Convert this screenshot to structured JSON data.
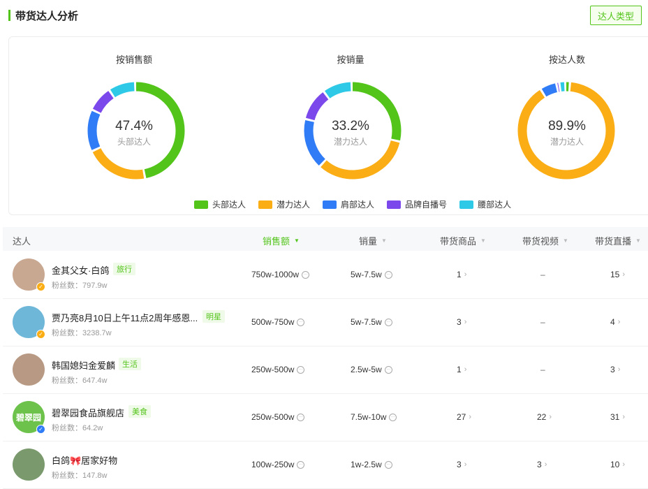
{
  "header": {
    "title": "带货达人分析",
    "type_button": "达人类型"
  },
  "colors": {
    "head": "#52c41a",
    "potential": "#faad14",
    "shoulder": "#2f7cf6",
    "brand": "#7b48ec",
    "waist": "#2ec9e6"
  },
  "charts": [
    {
      "title": "按销售额",
      "center_pct": "47.4%",
      "center_label": "头部达人"
    },
    {
      "title": "按销量",
      "center_pct": "33.2%",
      "center_label": "潜力达人"
    },
    {
      "title": "按达人数",
      "center_pct": "89.9%",
      "center_label": "潜力达人"
    }
  ],
  "chart_data": [
    {
      "type": "pie",
      "title": "按销售额",
      "categories": [
        "头部达人",
        "潜力达人",
        "肩部达人",
        "品牌自播号",
        "腰部达人"
      ],
      "values": [
        47.4,
        21.0,
        14.0,
        8.6,
        9.0
      ]
    },
    {
      "type": "pie",
      "title": "按销量",
      "categories": [
        "头部达人",
        "潜力达人",
        "肩部达人",
        "品牌自播号",
        "腰部达人"
      ],
      "values": [
        29.0,
        33.2,
        17.0,
        11.0,
        9.8
      ]
    },
    {
      "type": "pie",
      "title": "按达人数",
      "categories": [
        "头部达人",
        "潜力达人",
        "肩部达人",
        "品牌自播号",
        "腰部达人"
      ],
      "values": [
        1.6,
        89.9,
        5.5,
        1.0,
        2.0
      ]
    }
  ],
  "legend": [
    "头部达人",
    "潜力达人",
    "肩部达人",
    "品牌自播号",
    "腰部达人"
  ],
  "table": {
    "headers": {
      "influencer": "达人",
      "sales_amount": "销售额",
      "sales_volume": "销量",
      "products": "带货商品",
      "videos": "带货视频",
      "lives": "带货直播"
    },
    "rows": [
      {
        "name": "金其父女·白鸽",
        "tag": "旅行",
        "fans": "粉丝数：797.9w",
        "sales_amount": "750w-1000w",
        "sales_volume": "5w-7.5w",
        "products": "1",
        "videos": "–",
        "lives": "15",
        "verify_color": "#faad14",
        "avatar_color": "#c9a892"
      },
      {
        "name": "贾乃亮8月10日上午11点2周年感恩...",
        "tag": "明星",
        "fans": "粉丝数：3238.7w",
        "sales_amount": "500w-750w",
        "sales_volume": "5w-7.5w",
        "products": "3",
        "videos": "–",
        "lives": "4",
        "verify_color": "#faad14",
        "avatar_color": "#6fb7d8"
      },
      {
        "name": "韩国媳妇金爱麟",
        "tag": "生活",
        "fans": "粉丝数：647.4w",
        "sales_amount": "250w-500w",
        "sales_volume": "2.5w-5w",
        "products": "1",
        "videos": "–",
        "lives": "3",
        "verify_color": "",
        "avatar_color": "#b89a84"
      },
      {
        "name": "碧翠园食品旗舰店",
        "tag": "美食",
        "fans": "粉丝数：64.2w",
        "sales_amount": "250w-500w",
        "sales_volume": "7.5w-10w",
        "products": "27",
        "videos": "22",
        "lives": "31",
        "verify_color": "#2f7cf6",
        "avatar_color": "#6cc24a",
        "avatar_text": "碧翠园"
      },
      {
        "name": "白鸽🎀居家好物",
        "tag": "",
        "fans": "粉丝数：147.8w",
        "sales_amount": "100w-250w",
        "sales_volume": "1w-2.5w",
        "products": "3",
        "videos": "3",
        "lives": "10",
        "verify_color": "",
        "avatar_color": "#7a9a6e"
      }
    ]
  }
}
